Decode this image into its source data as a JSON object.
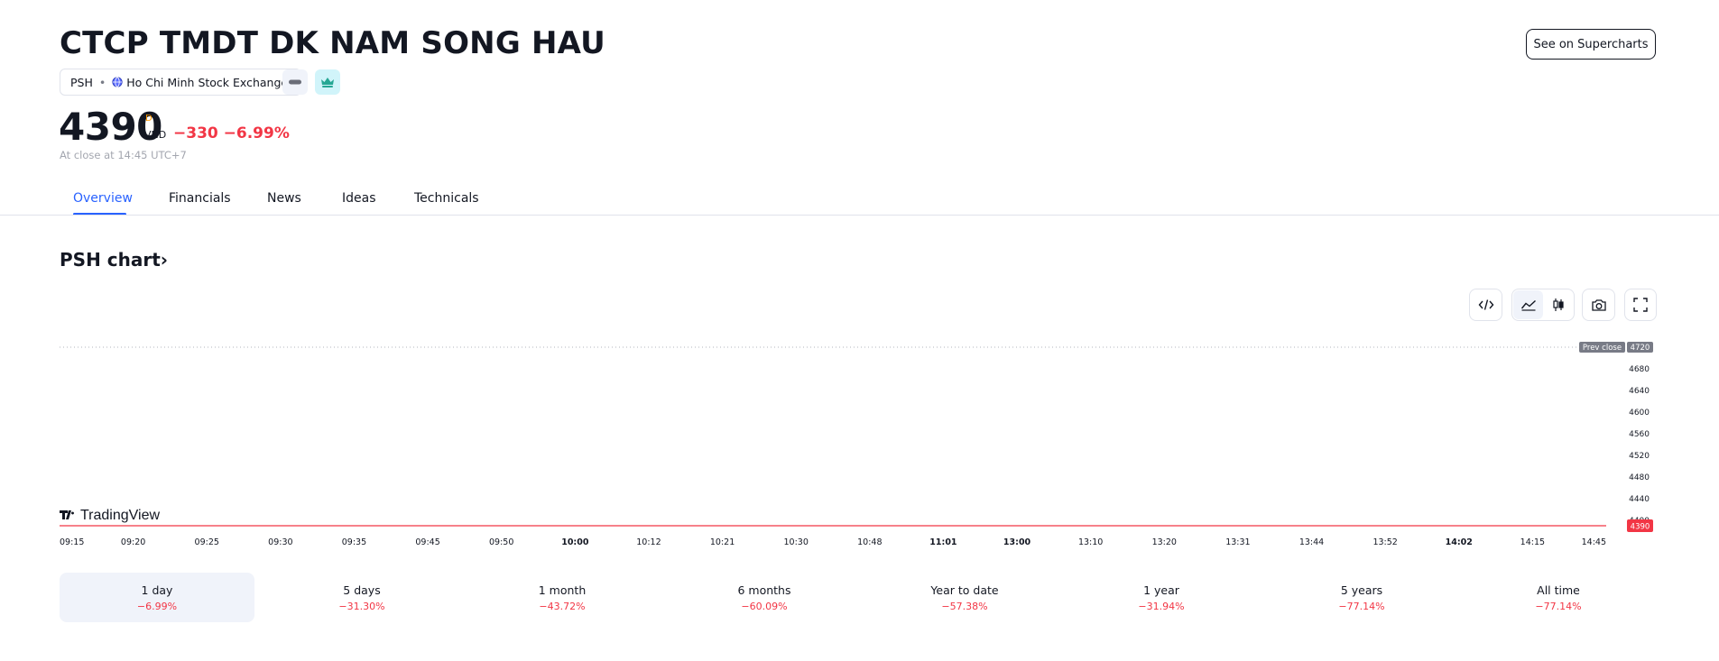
{
  "header": {
    "title": "CTCP TMDT DK NAM SONG HAU",
    "see_button": "See on Supercharts",
    "ticker": "PSH",
    "exchange": "Ho Chi Minh Stock Exchange"
  },
  "quote": {
    "price": "4390",
    "session_flag": "D",
    "currency": "VND",
    "change": "−330",
    "change_percent": "−6.99%",
    "close_note": "At close at 14:45 UTC+7"
  },
  "tabs": [
    {
      "label": "Overview",
      "active": true
    },
    {
      "label": "Financials"
    },
    {
      "label": "News"
    },
    {
      "label": "Ideas"
    },
    {
      "label": "Technicals"
    }
  ],
  "chart_section": {
    "heading": "PSH chart",
    "chevron": "›",
    "tools": [
      "embed-code-icon",
      "area-chart-icon",
      "candles-icon",
      "camera-icon",
      "fullscreen-icon"
    ]
  },
  "chart_data": {
    "type": "line",
    "x_ticks": [
      {
        "label": "09:15",
        "bold": false
      },
      {
        "label": "09:20",
        "bold": false
      },
      {
        "label": "09:25",
        "bold": false
      },
      {
        "label": "09:30",
        "bold": false
      },
      {
        "label": "09:35",
        "bold": false
      },
      {
        "label": "09:45",
        "bold": false
      },
      {
        "label": "09:50",
        "bold": false
      },
      {
        "label": "10:00",
        "bold": true
      },
      {
        "label": "10:12",
        "bold": false
      },
      {
        "label": "10:21",
        "bold": false
      },
      {
        "label": "10:30",
        "bold": false
      },
      {
        "label": "10:48",
        "bold": false
      },
      {
        "label": "11:01",
        "bold": true
      },
      {
        "label": "13:00",
        "bold": true
      },
      {
        "label": "13:10",
        "bold": false
      },
      {
        "label": "13:20",
        "bold": false
      },
      {
        "label": "13:31",
        "bold": false
      },
      {
        "label": "13:44",
        "bold": false
      },
      {
        "label": "13:52",
        "bold": false
      },
      {
        "label": "14:02",
        "bold": true
      },
      {
        "label": "14:15",
        "bold": false
      },
      {
        "label": "14:45",
        "bold": false
      }
    ],
    "y_ticks": [
      4680,
      4640,
      4600,
      4560,
      4520,
      4480,
      4440,
      4400
    ],
    "y_range": [
      4390,
      4720
    ],
    "series": [
      {
        "x": [
          "09:15",
          "14:45"
        ],
        "y": [
          4390,
          4390
        ],
        "color": "#f23645"
      }
    ],
    "prev_close": {
      "label": "Prev close",
      "value": 4720
    },
    "last_value": 4390,
    "watermark": "TradingView",
    "grid": false
  },
  "ranges": [
    {
      "label": "1 day",
      "value": "−6.99%",
      "active": true
    },
    {
      "label": "5 days",
      "value": "−31.30%"
    },
    {
      "label": "1 month",
      "value": "−43.72%"
    },
    {
      "label": "6 months",
      "value": "−60.09%"
    },
    {
      "label": "Year to date",
      "value": "−57.38%"
    },
    {
      "label": "1 year",
      "value": "−31.94%"
    },
    {
      "label": "5 years",
      "value": "−77.14%"
    },
    {
      "label": "All time",
      "value": "−77.14%"
    }
  ],
  "colors": {
    "accent": "#2962ff",
    "negative": "#f23645",
    "text": "#131722",
    "muted": "#a3a6af",
    "flag": "#ff9800"
  }
}
